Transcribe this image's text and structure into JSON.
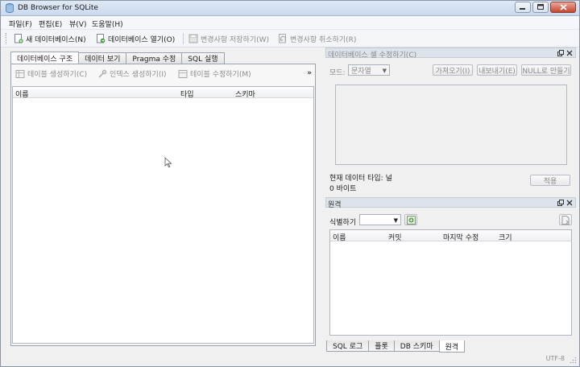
{
  "window": {
    "title": "DB Browser for SQLite"
  },
  "menu": [
    "파일(F)",
    "편집(E)",
    "뷰(V)",
    "도움말(H)"
  ],
  "toolbar": {
    "new_db": "새 데이터베이스(N)",
    "open_db": "데이터베이스 열기(O)",
    "write_changes": "변경사항 저장하기(W)",
    "revert_changes": "변경사항 취소하기(R)"
  },
  "left_tabs": [
    "데이터베이스 구조",
    "데이터 보기",
    "Pragma 수정",
    "SQL 실행"
  ],
  "structure_toolbar": {
    "create_table": "테이블 생성하기(C)",
    "create_index": "인덱스 생성하기(I)",
    "modify_table": "테이블 수정하기(M)",
    "more": "»"
  },
  "structure_columns": [
    "이름",
    "타입",
    "스키마"
  ],
  "edit_cell": {
    "title": "데이터베이스 셀 수정하기(C)",
    "mode_label": "모드:",
    "mode_value": "문자열",
    "import_btn": "가져오기(I)",
    "export_btn": "내보내기(E)",
    "null_btn": "NULL로 만들기",
    "type_text": "현재 데이터 타입: 널",
    "size_text": "0 바이트",
    "apply_btn": "적용"
  },
  "remote": {
    "title": "원격",
    "identity_label": "식별하기",
    "columns": [
      "이름",
      "커밋",
      "마지막 수정",
      "크기"
    ]
  },
  "bottom_tabs": [
    "SQL 로그",
    "플롯",
    "DB 스키마",
    "원격"
  ],
  "status": {
    "encoding": "UTF-8"
  }
}
